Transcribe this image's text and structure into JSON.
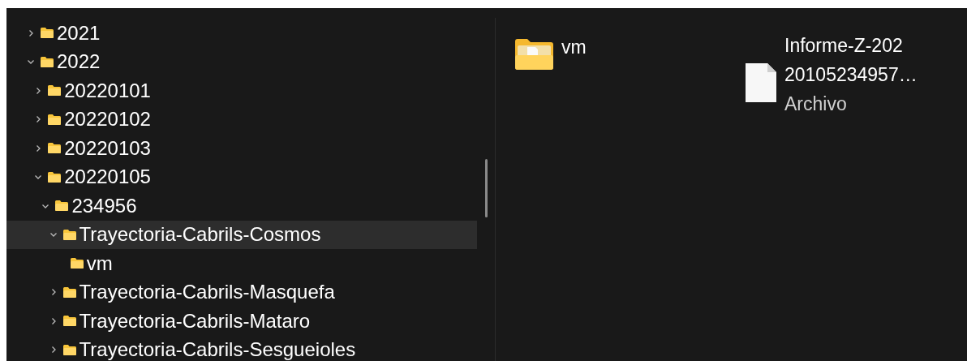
{
  "tree": [
    {
      "label": "2021",
      "kind": "expandable",
      "expanded": false,
      "selected": false
    },
    {
      "label": "2022",
      "kind": "expandable",
      "expanded": true,
      "selected": false,
      "children": [
        {
          "label": "20220101",
          "kind": "expandable",
          "expanded": false,
          "selected": false
        },
        {
          "label": "20220102",
          "kind": "expandable",
          "expanded": false,
          "selected": false
        },
        {
          "label": "20220103",
          "kind": "expandable",
          "expanded": false,
          "selected": false
        },
        {
          "label": "20220105",
          "kind": "expandable",
          "expanded": true,
          "selected": false,
          "children": [
            {
              "label": "234956",
              "kind": "expandable",
              "expanded": true,
              "selected": false,
              "children": [
                {
                  "label": "Trayectoria-Cabrils-Cosmos",
                  "kind": "expandable",
                  "expanded": true,
                  "selected": true,
                  "children": [
                    {
                      "label": "vm",
                      "kind": "leaf",
                      "selected": false
                    }
                  ]
                },
                {
                  "label": "Trayectoria-Cabrils-Masquefa",
                  "kind": "expandable",
                  "expanded": false,
                  "selected": false
                },
                {
                  "label": "Trayectoria-Cabrils-Mataro",
                  "kind": "expandable",
                  "expanded": false,
                  "selected": false
                },
                {
                  "label": "Trayectoria-Cabrils-Sesgueioles",
                  "kind": "expandable",
                  "expanded": false,
                  "selected": false
                }
              ]
            }
          ]
        }
      ]
    }
  ],
  "files": [
    {
      "kind": "folder",
      "name_lines": [
        "vm"
      ]
    },
    {
      "kind": "file",
      "name_lines": [
        "Informe-Z-202",
        "20105234957…"
      ],
      "type": "Archivo"
    }
  ]
}
